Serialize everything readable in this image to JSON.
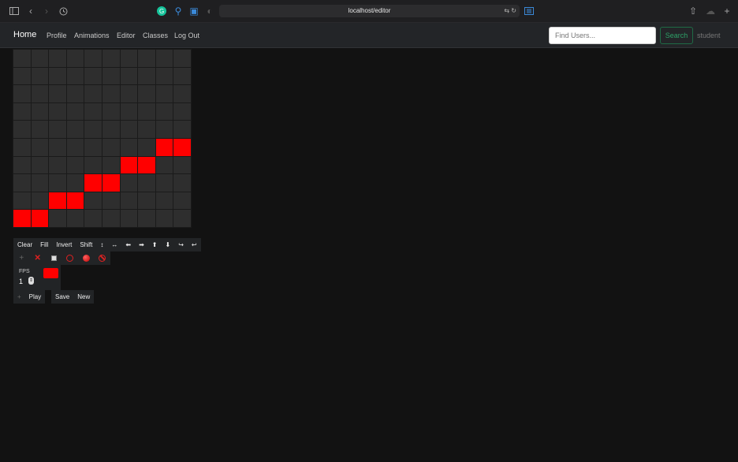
{
  "browser": {
    "url": "localhost/editor",
    "icons": [
      "sidebar-icon",
      "back-icon",
      "forward-icon",
      "history-icon",
      "grammarly-icon",
      "extension-icon",
      "password-icon",
      "shield-icon",
      "translate-icon",
      "reload-icon",
      "reader-icon",
      "share-icon",
      "cloud-icon",
      "new-tab-icon"
    ]
  },
  "navbar": {
    "brand": "Home",
    "links": [
      "Profile",
      "Animations",
      "Editor",
      "Classes",
      "Log Out"
    ],
    "search_placeholder": "Find Users...",
    "search_button": "Search",
    "user": "student"
  },
  "grid": {
    "rows": 10,
    "cols": 10,
    "on_color": "#ff0000",
    "off_color": "#2e2e2e",
    "lit_cells": [
      [
        5,
        8
      ],
      [
        5,
        9
      ],
      [
        6,
        6
      ],
      [
        6,
        7
      ],
      [
        7,
        4
      ],
      [
        7,
        5
      ],
      [
        8,
        2
      ],
      [
        8,
        3
      ],
      [
        9,
        0
      ],
      [
        9,
        1
      ]
    ]
  },
  "toolbar": {
    "clear": "Clear",
    "fill": "Fill",
    "invert": "Invert",
    "shift": "Shift",
    "arrows": [
      "↕",
      "↔",
      "⬅",
      "➡",
      "⬆",
      "⬇",
      "↪",
      "↩"
    ]
  },
  "tools": {
    "icons": [
      "add-icon",
      "delete-icon",
      "square-icon",
      "ring-icon",
      "dot-icon",
      "ban-icon"
    ]
  },
  "fps": {
    "label": "FPS",
    "value": "1",
    "color": "#ff0000"
  },
  "playback": {
    "play": "Play",
    "save": "Save",
    "new": "New"
  }
}
